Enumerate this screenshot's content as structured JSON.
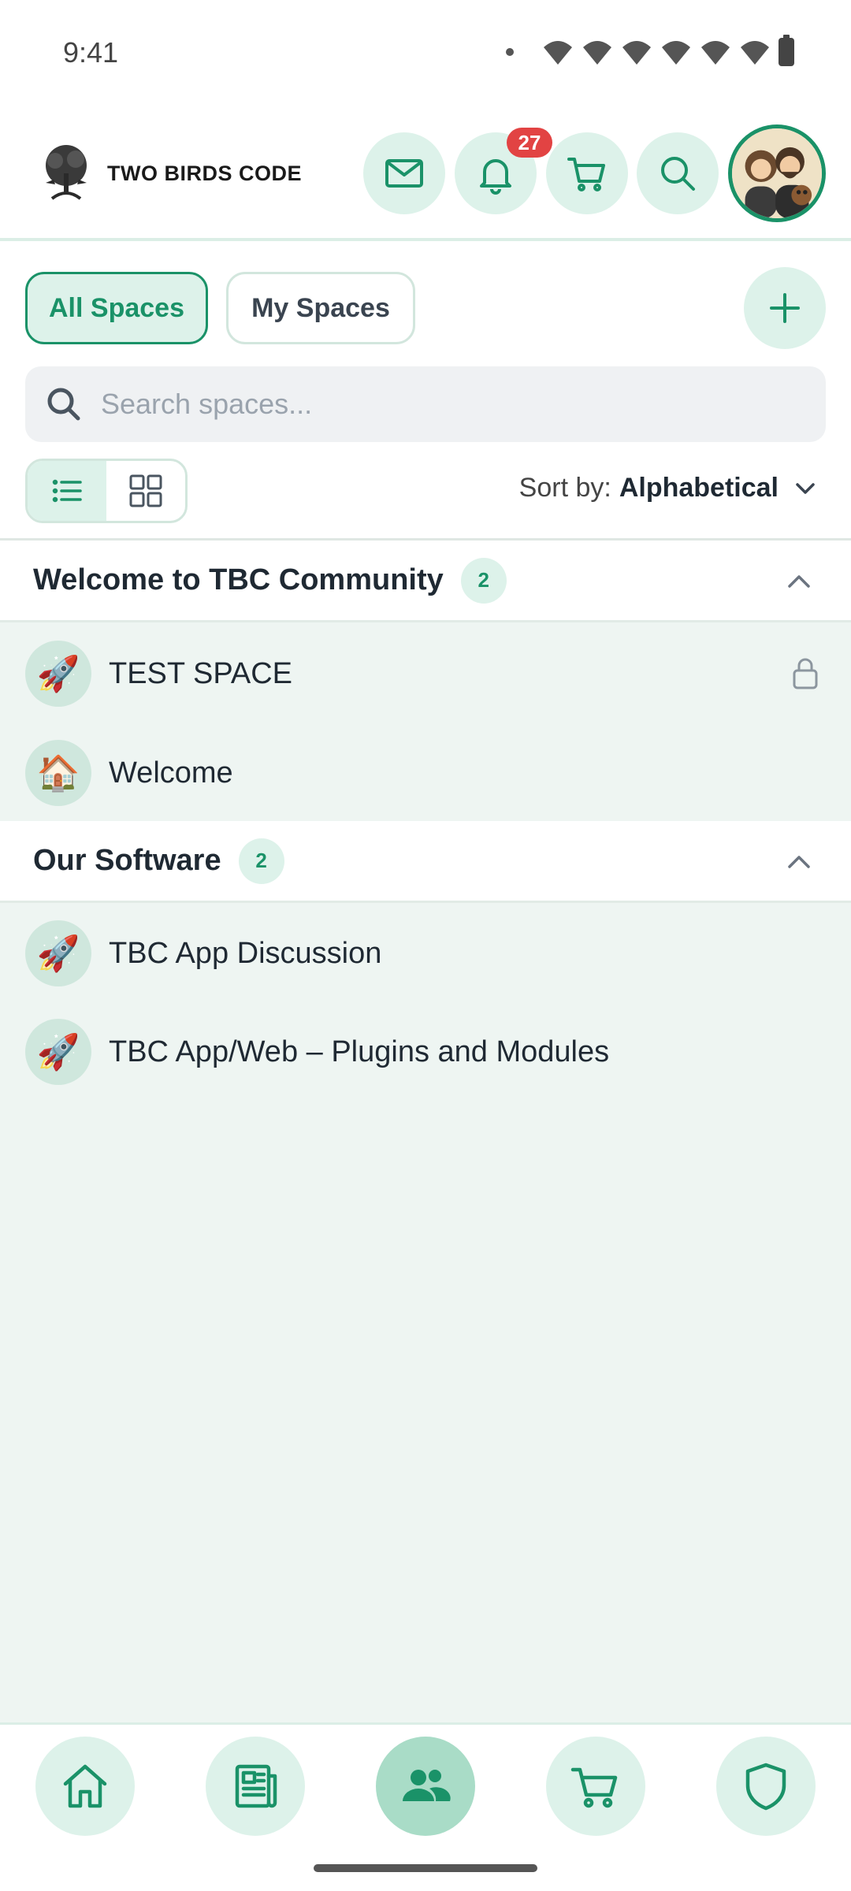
{
  "status_bar": {
    "time": "9:41"
  },
  "header": {
    "brand_name": "TWO BIRDS CODE",
    "notification_count": "27",
    "icons": [
      "mail-icon",
      "bell-icon",
      "cart-icon",
      "search-icon"
    ]
  },
  "filters": {
    "all_spaces": "All Spaces",
    "my_spaces": "My Spaces",
    "active": "All Spaces"
  },
  "search": {
    "placeholder": "Search spaces..."
  },
  "sort": {
    "label": "Sort by:",
    "value": "Alphabetical"
  },
  "groups": [
    {
      "title": "Welcome to TBC Community",
      "count": "2",
      "spaces": [
        {
          "name": "TEST SPACE",
          "icon": "🚀",
          "locked": true
        },
        {
          "name": "Welcome",
          "icon": "🏠",
          "locked": false
        }
      ]
    },
    {
      "title": "Our Software",
      "count": "2",
      "spaces": [
        {
          "name": "TBC App Discussion",
          "icon": "🚀",
          "locked": false
        },
        {
          "name": "TBC App/Web – Plugins and Modules",
          "icon": "🚀",
          "locked": false
        }
      ]
    }
  ],
  "bottom_nav": {
    "items": [
      "home-icon",
      "news-icon",
      "community-icon",
      "cart-icon",
      "shield-icon"
    ],
    "active": "community-icon"
  },
  "colors": {
    "accent": "#1a9268",
    "accent_light": "#ddf2ea",
    "badge": "#e24343"
  }
}
